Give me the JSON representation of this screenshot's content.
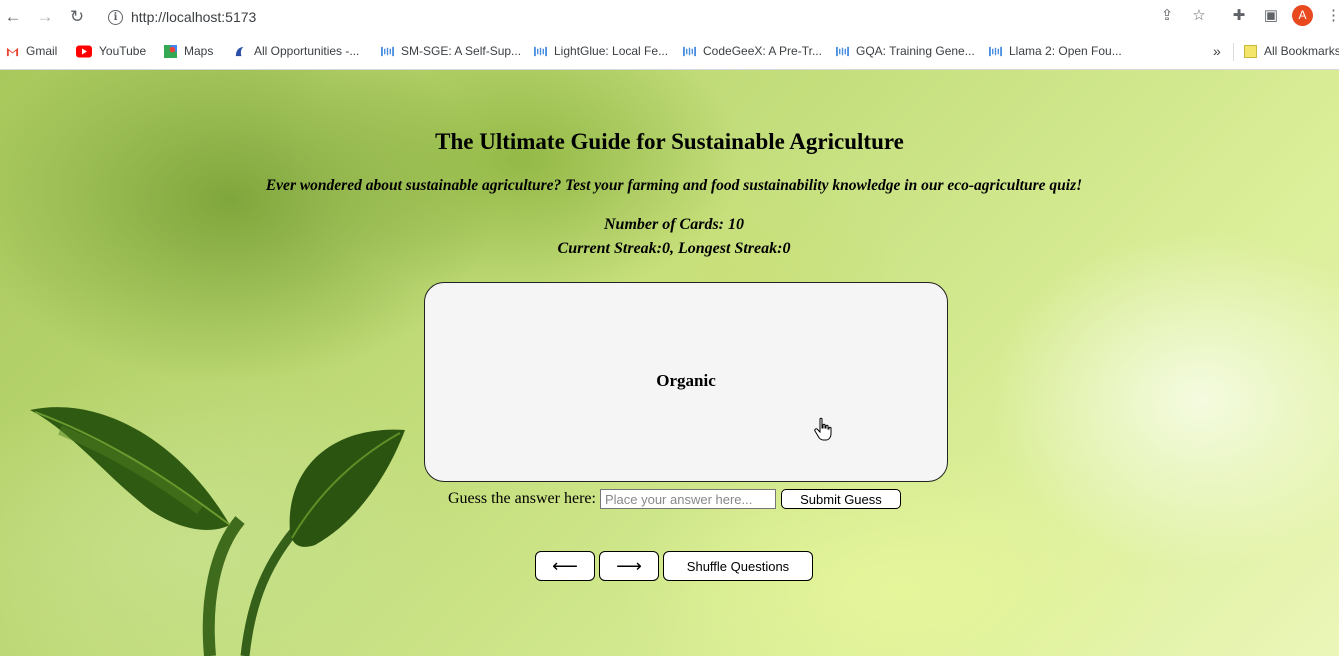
{
  "browser": {
    "url": "http://localhost:5173",
    "avatar_letter": "A",
    "bookmarks": [
      {
        "label": "Gmail",
        "icon": "gmail-icon"
      },
      {
        "label": "YouTube",
        "icon": "youtube-icon"
      },
      {
        "label": "Maps",
        "icon": "maps-icon"
      },
      {
        "label": "All Opportunities -...",
        "icon": "opportunities-icon"
      },
      {
        "label": "SM-SGE: A Self-Sup...",
        "icon": "paper-icon"
      },
      {
        "label": "LightGlue: Local Fe...",
        "icon": "paper-icon"
      },
      {
        "label": "CodeGeeX: A Pre-Tr...",
        "icon": "paper-icon"
      },
      {
        "label": "GQA: Training Gene...",
        "icon": "paper-icon"
      },
      {
        "label": "Llama 2: Open Fou...",
        "icon": "paper-icon"
      }
    ],
    "all_bookmarks_label": "All Bookmarks",
    "overflow_label": "»"
  },
  "page": {
    "title": "The Ultimate Guide for Sustainable Agriculture",
    "subtitle": "Ever wondered about sustainable agriculture? Test your farming and food sustainability knowledge in our eco-agriculture quiz!",
    "card_count": "Number of Cards: 10",
    "streak": "Current Streak:0, Longest Streak:0",
    "card_text": "Organic",
    "guess_label": "Guess the answer here:",
    "guess_placeholder": "Place your answer here...",
    "submit_label": "Submit Guess",
    "prev_label": "⟵",
    "next_label": "⟶",
    "shuffle_label": "Shuffle Questions"
  },
  "colors": {
    "youtube_red": "#ff0000",
    "avatar_bg": "#e8491f",
    "leaf_dark": "#2f5a12",
    "card_bg": "#f5f5f5"
  }
}
